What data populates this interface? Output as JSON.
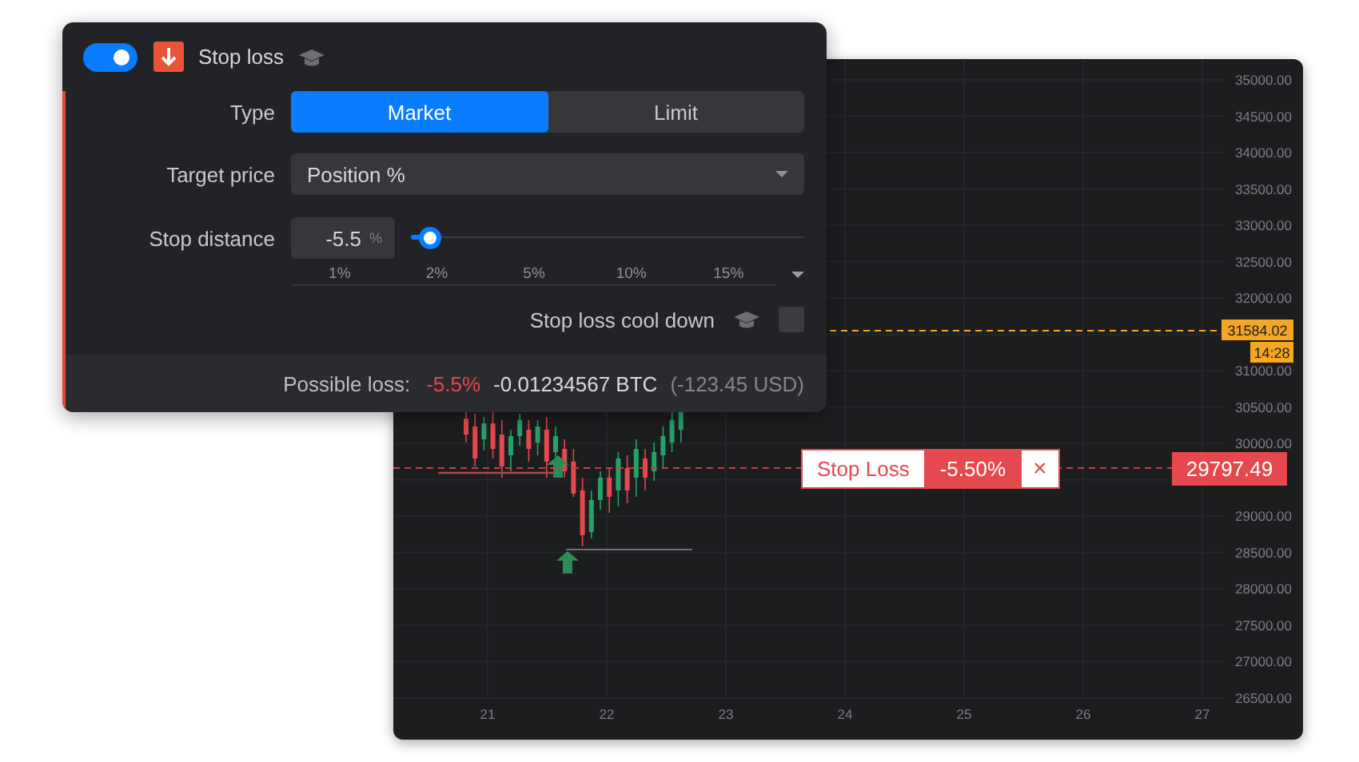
{
  "panel": {
    "enabled": true,
    "title": "Stop loss",
    "type": {
      "label": "Type",
      "options": [
        {
          "label": "Market",
          "selected": true
        },
        {
          "label": "Limit",
          "selected": false
        }
      ]
    },
    "target_price": {
      "label": "Target price",
      "value": "Position %"
    },
    "stop_distance": {
      "label": "Stop distance",
      "value": "-5.5",
      "unit": "%",
      "level": 0.05,
      "presets": [
        "1%",
        "2%",
        "5%",
        "10%",
        "15%"
      ]
    },
    "cool_down": {
      "label": "Stop loss cool down",
      "checked": false
    },
    "possible_loss": {
      "label": "Possible loss:",
      "percent": "-5.5%",
      "amount": "-0.01234567 BTC",
      "usd": "(-123.45 USD)"
    }
  },
  "chart": {
    "price_axis": [
      "35000.00",
      "34500.00",
      "34000.00",
      "33500.00",
      "33000.00",
      "32500.00",
      "32000.00",
      "31000.00",
      "30500.00",
      "30000.00",
      "29000.00",
      "28500.00",
      "28000.00",
      "27500.00",
      "27000.00",
      "26500.00"
    ],
    "time_axis": [
      "21",
      "22",
      "23",
      "24",
      "25",
      "26",
      "27"
    ],
    "current_price": {
      "price": "31584.02",
      "countdown": "14:28"
    },
    "stop_loss_line": {
      "label": "Stop Loss",
      "percent": "-5.50%",
      "close": "×",
      "price": "29797.49"
    }
  }
}
